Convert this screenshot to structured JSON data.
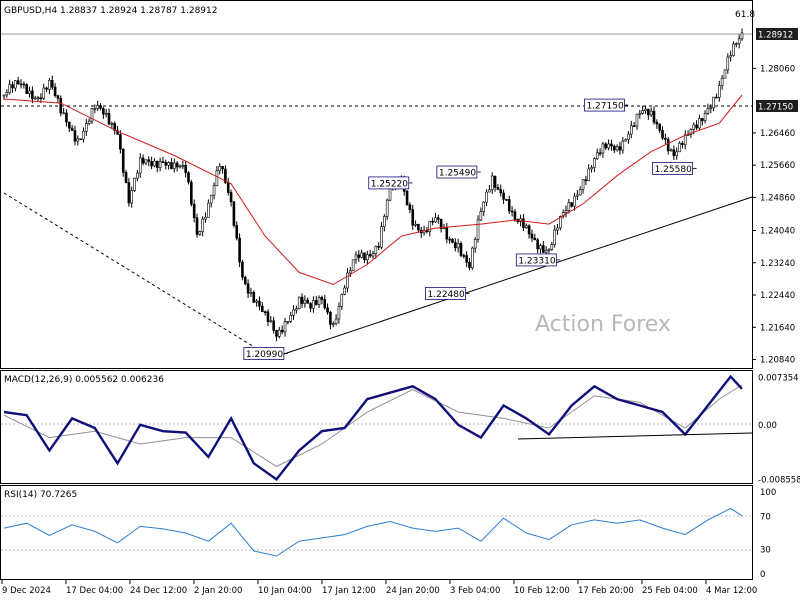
{
  "colors": {
    "background": "#ffffff",
    "candle": "#000000",
    "ma": "#d11a1a",
    "macd_line": "#10107a",
    "macd_signal": "#909090",
    "rsi_line": "#2a7fd4",
    "trendline": "#000000",
    "watermark": "#b8b8b8",
    "price_tag_bg": "#1e1e1e",
    "price_tag_text": "#ffffff"
  },
  "main": {
    "header": "GBPUSD,H4  1.28837 1.28924 1.28787 1.28912",
    "fib_label": "61.8",
    "watermark": "Action Forex",
    "y_ticks": [
      "1.28060",
      "1.26460",
      "1.25660",
      "1.24860",
      "1.24040",
      "1.23240",
      "1.22440",
      "1.21640",
      "1.20840"
    ],
    "current_price_tag": "1.28912",
    "level_tag": "1.27150",
    "callouts": [
      "1.27150",
      "1.25220",
      "1.25490",
      "1.25580",
      "1.23310",
      "1.22480",
      "1.20990"
    ]
  },
  "macd": {
    "header": "MACD(12,26,9) 0.005562 0.006236",
    "y_ticks": [
      "0.007354",
      "0.00",
      "-0.008558"
    ]
  },
  "rsi": {
    "header": "RSI(14) 70.7265",
    "y_ticks": [
      "100",
      "70",
      "30",
      "0"
    ]
  },
  "x_labels": [
    "9 Dec 2024",
    "17 Dec 04:00",
    "24 Dec 12:00",
    "2 Jan 20:00",
    "10 Jan 04:00",
    "17 Jan 12:00",
    "24 Jan 20:00",
    "3 Feb 04:00",
    "10 Feb 12:00",
    "17 Feb 20:00",
    "25 Feb 04:00",
    "4 Mar 12:00"
  ],
  "chart_data": [
    {
      "type": "candlestick",
      "title": "GBPUSD,H4",
      "ohlc_last": {
        "open": 1.28837,
        "high": 1.28924,
        "low": 1.28787,
        "close": 1.28912
      },
      "ylim": [
        1.2068,
        1.2926
      ],
      "swing_points": [
        {
          "x": "10 Jan",
          "y": 1.2099,
          "label": "1.20990"
        },
        {
          "x": "23 Jan",
          "y": 1.2522,
          "label": "1.25220"
        },
        {
          "x": "2 Feb",
          "y": 1.2248,
          "label": "1.22480"
        },
        {
          "x": "4 Feb",
          "y": 1.2549,
          "label": "1.25490"
        },
        {
          "x": "11 Feb",
          "y": 1.2331,
          "label": "1.23310"
        },
        {
          "x": "20 Feb",
          "y": 1.2715,
          "label": "1.27150"
        },
        {
          "x": "27 Feb",
          "y": 1.2558,
          "label": "1.25580"
        }
      ],
      "horizontal_level": 1.2715,
      "close_path": [
        [
          0,
          1.274
        ],
        [
          3,
          1.276
        ],
        [
          6,
          1.2745
        ],
        [
          8,
          1.2765
        ],
        [
          10,
          1.269
        ],
        [
          13,
          1.264
        ],
        [
          16,
          1.27
        ],
        [
          18,
          1.268
        ],
        [
          20,
          1.266
        ],
        [
          22,
          1.248
        ],
        [
          24,
          1.256
        ],
        [
          26,
          1.257
        ],
        [
          28,
          1.259
        ],
        [
          30,
          1.256
        ],
        [
          32,
          1.254
        ],
        [
          34,
          1.24
        ],
        [
          36,
          1.248
        ],
        [
          38,
          1.256
        ],
        [
          40,
          1.246
        ],
        [
          42,
          1.23
        ],
        [
          44,
          1.224
        ],
        [
          46,
          1.218
        ],
        [
          48,
          1.214
        ],
        [
          50,
          1.22
        ],
        [
          52,
          1.223
        ],
        [
          54,
          1.22
        ],
        [
          56,
          1.224
        ],
        [
          58,
          1.218
        ],
        [
          60,
          1.226
        ],
        [
          62,
          1.233
        ],
        [
          64,
          1.235
        ],
        [
          66,
          1.238
        ],
        [
          68,
          1.25
        ],
        [
          70,
          1.252
        ],
        [
          72,
          1.244
        ],
        [
          74,
          1.24
        ],
        [
          76,
          1.242
        ],
        [
          78,
          1.239
        ],
        [
          80,
          1.238
        ],
        [
          82,
          1.231
        ],
        [
          84,
          1.244
        ],
        [
          86,
          1.254
        ],
        [
          88,
          1.25
        ],
        [
          90,
          1.242
        ],
        [
          92,
          1.24
        ],
        [
          94,
          1.238
        ],
        [
          96,
          1.236
        ],
        [
          98,
          1.242
        ],
        [
          100,
          1.247
        ],
        [
          102,
          1.254
        ],
        [
          104,
          1.258
        ],
        [
          106,
          1.26
        ],
        [
          108,
          1.261
        ],
        [
          110,
          1.266
        ],
        [
          112,
          1.269
        ],
        [
          114,
          1.268
        ],
        [
          116,
          1.265
        ],
        [
          118,
          1.26
        ],
        [
          120,
          1.262
        ],
        [
          122,
          1.266
        ],
        [
          124,
          1.272
        ],
        [
          126,
          1.276
        ],
        [
          128,
          1.283
        ],
        [
          130,
          1.2891
        ]
      ],
      "ma_path": [
        [
          0,
          1.273
        ],
        [
          10,
          1.272
        ],
        [
          20,
          1.265
        ],
        [
          30,
          1.259
        ],
        [
          40,
          1.252
        ],
        [
          46,
          1.239
        ],
        [
          52,
          1.23
        ],
        [
          58,
          1.227
        ],
        [
          64,
          1.232
        ],
        [
          70,
          1.239
        ],
        [
          76,
          1.241
        ],
        [
          84,
          1.242
        ],
        [
          90,
          1.243
        ],
        [
          96,
          1.242
        ],
        [
          102,
          1.247
        ],
        [
          108,
          1.254
        ],
        [
          114,
          1.26
        ],
        [
          120,
          1.264
        ],
        [
          126,
          1.267
        ],
        [
          130,
          1.274
        ]
      ]
    },
    {
      "type": "line",
      "title": "MACD(12,26,9)",
      "values_last": {
        "macd": 0.005562,
        "signal": 0.006236
      },
      "ylim": [
        -0.0086,
        0.0076
      ],
      "series": [
        {
          "name": "MACD",
          "points": [
            [
              0,
              0.002
            ],
            [
              4,
              0.0015
            ],
            [
              8,
              -0.004
            ],
            [
              12,
              0.001
            ],
            [
              16,
              -0.0005
            ],
            [
              20,
              -0.006
            ],
            [
              24,
              0.0
            ],
            [
              28,
              -0.001
            ],
            [
              32,
              -0.0012
            ],
            [
              36,
              -0.005
            ],
            [
              40,
              0.001
            ],
            [
              44,
              -0.006
            ],
            [
              48,
              -0.0085
            ],
            [
              52,
              -0.004
            ],
            [
              56,
              -0.001
            ],
            [
              60,
              -0.0005
            ],
            [
              64,
              0.004
            ],
            [
              68,
              0.005
            ],
            [
              72,
              0.006
            ],
            [
              76,
              0.004
            ],
            [
              80,
              0.0
            ],
            [
              84,
              -0.002
            ],
            [
              88,
              0.003
            ],
            [
              92,
              0.001
            ],
            [
              96,
              -0.0015
            ],
            [
              100,
              0.003
            ],
            [
              104,
              0.006
            ],
            [
              108,
              0.004
            ],
            [
              112,
              0.003
            ],
            [
              116,
              0.002
            ],
            [
              120,
              -0.0015
            ],
            [
              124,
              0.003
            ],
            [
              128,
              0.0075
            ],
            [
              130,
              0.0056
            ]
          ]
        },
        {
          "name": "Signal",
          "points": [
            [
              0,
              0.0015
            ],
            [
              8,
              -0.002
            ],
            [
              16,
              -0.001
            ],
            [
              24,
              -0.003
            ],
            [
              32,
              -0.002
            ],
            [
              40,
              -0.002
            ],
            [
              48,
              -0.0065
            ],
            [
              56,
              -0.003
            ],
            [
              64,
              0.002
            ],
            [
              72,
              0.0055
            ],
            [
              80,
              0.002
            ],
            [
              88,
              0.001
            ],
            [
              96,
              -0.0005
            ],
            [
              104,
              0.0045
            ],
            [
              112,
              0.0035
            ],
            [
              120,
              -0.0005
            ],
            [
              126,
              0.004
            ],
            [
              130,
              0.0062
            ]
          ]
        }
      ]
    },
    {
      "type": "line",
      "title": "RSI(14)",
      "value_last": 70.7265,
      "ylim": [
        0,
        100
      ],
      "levels": [
        70,
        30
      ],
      "series": [
        {
          "name": "RSI",
          "points": [
            [
              0,
              56
            ],
            [
              4,
              62
            ],
            [
              8,
              47
            ],
            [
              12,
              60
            ],
            [
              16,
              52
            ],
            [
              20,
              38
            ],
            [
              24,
              58
            ],
            [
              28,
              55
            ],
            [
              32,
              50
            ],
            [
              36,
              40
            ],
            [
              40,
              62
            ],
            [
              44,
              28
            ],
            [
              48,
              22
            ],
            [
              52,
              40
            ],
            [
              56,
              44
            ],
            [
              60,
              48
            ],
            [
              64,
              58
            ],
            [
              68,
              64
            ],
            [
              72,
              56
            ],
            [
              76,
              52
            ],
            [
              80,
              56
            ],
            [
              84,
              40
            ],
            [
              88,
              68
            ],
            [
              92,
              50
            ],
            [
              96,
              42
            ],
            [
              100,
              60
            ],
            [
              104,
              66
            ],
            [
              108,
              62
            ],
            [
              112,
              66
            ],
            [
              116,
              56
            ],
            [
              120,
              48
            ],
            [
              124,
              66
            ],
            [
              128,
              80
            ],
            [
              130,
              71
            ]
          ]
        }
      ]
    }
  ]
}
